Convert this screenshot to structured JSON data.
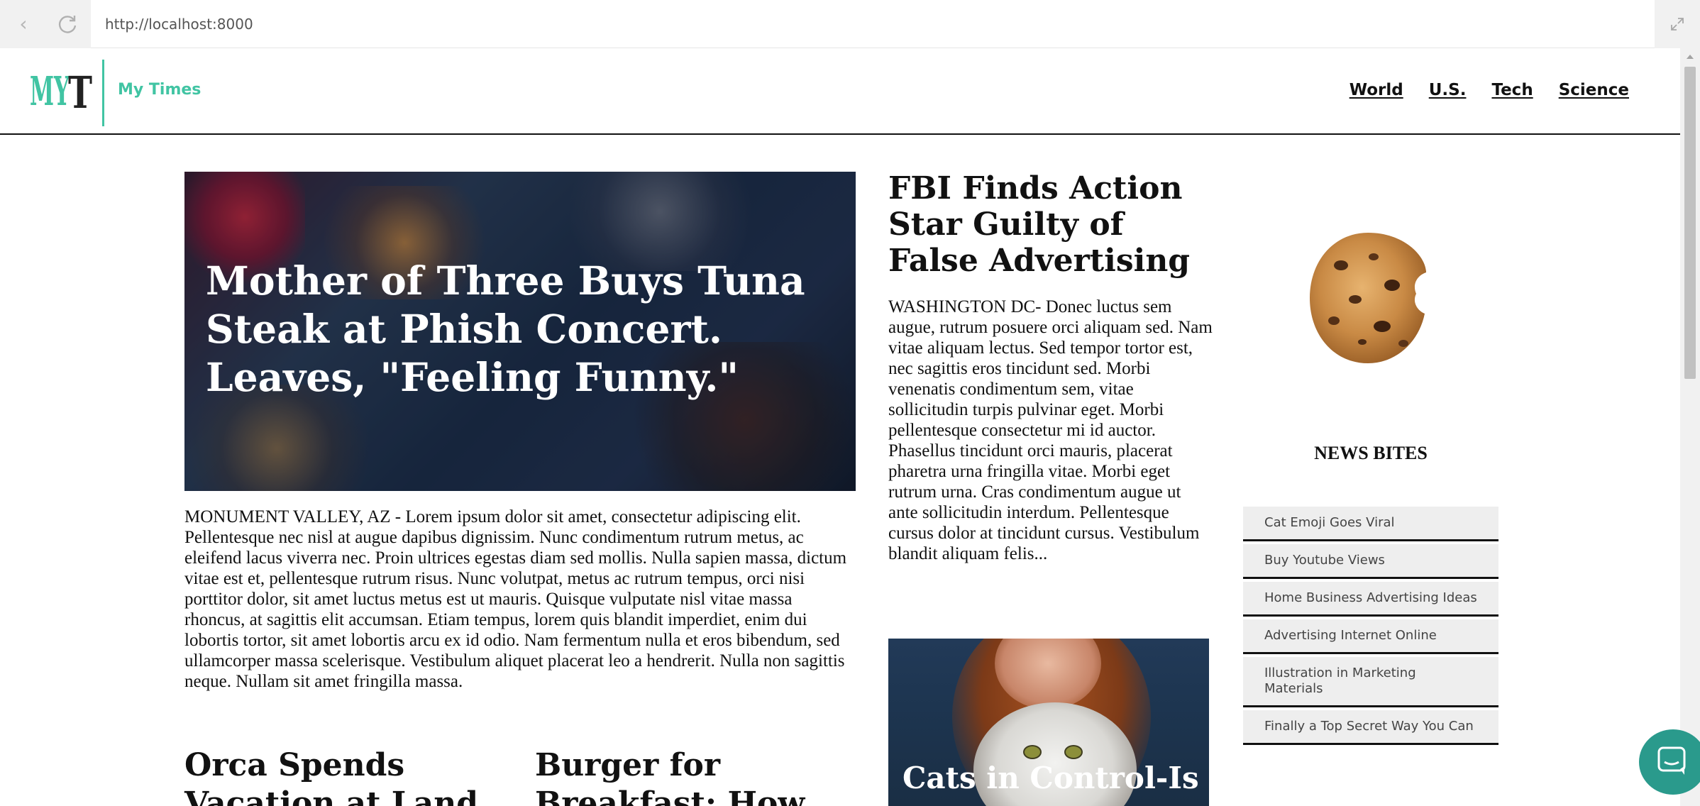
{
  "browser": {
    "url": "http://localhost:8000",
    "back_glyph": "‹"
  },
  "site": {
    "logo_text": "MYT",
    "name": "My Times",
    "brand_color": "#41c4a3",
    "nav": [
      {
        "label": "World"
      },
      {
        "label": "U.S."
      },
      {
        "label": "Tech"
      },
      {
        "label": "Science"
      }
    ]
  },
  "lead_story": {
    "title": "Mother of Three Buys Tuna Steak at Phish Concert. Leaves, \"Feeling Funny.\"",
    "body": "MONUMENT VALLEY, AZ - Lorem ipsum dolor sit amet, consectetur adipiscing elit. Pellentesque nec nisl at augue dapibus dignissim. Nunc condimentum rutrum metus, ac eleifend lacus viverra nec. Proin ultrices egestas diam sed mollis. Nulla sapien massa, dictum vitae est et, pellentesque rutrum risus. Nunc volutpat, metus ac rutrum tempus, orci nisi porttitor dolor, sit amet luctus metus est ut mauris. Quisque vulputate nisl vitae massa rhoncus, at sagittis elit accumsan. Etiam tempus, lorem quis blandit imperdiet, enim dui lobortis tortor, sit amet lobortis arcu ex id odio. Nam fermentum nulla et eros bibendum, sed ullamcorper massa scelerisque. Vestibulum aliquet placerat leo a hendrerit. Nulla non sagittis neque. Nullam sit amet fringilla massa."
  },
  "sub_stories": [
    {
      "title": "Orca Spends Vacation at Land"
    },
    {
      "title": "Burger for Breakfast: How"
    }
  ],
  "fbi_story": {
    "title": "FBI Finds Action Star Guilty of False Advertising",
    "body": "WASHINGTON DC- Donec luctus sem augue, rutrum posuere orci aliquam sed. Nam vitae aliquam lectus. Sed tempor tortor est, nec sagittis eros tincidunt sed. Morbi venenatis condimentum sem, vitae sollicitudin turpis pulvinar eget. Morbi pellentesque consectetur mi id auctor. Phasellus tincidunt orci mauris, placerat pharetra urna fringilla vitae. Morbi eget rutrum urna. Cras condimentum augue ut ante sollicitudin interdum. Pellentesque cursus dolor at tincidunt cursus. Vestibulum blandit aliquam felis..."
  },
  "cats_story": {
    "title": "Cats in Control-Is"
  },
  "news_bites": {
    "heading": "NEWS BITES",
    "items": [
      {
        "label": "Cat Emoji Goes Viral"
      },
      {
        "label": "Buy Youtube Views"
      },
      {
        "label": "Home Business Advertising Ideas"
      },
      {
        "label": "Advertising Internet Online"
      },
      {
        "label": "Illustration in Marketing Materials"
      },
      {
        "label": "Finally a Top Secret Way You Can"
      }
    ]
  },
  "chat": {
    "color": "#2a9a8c"
  }
}
